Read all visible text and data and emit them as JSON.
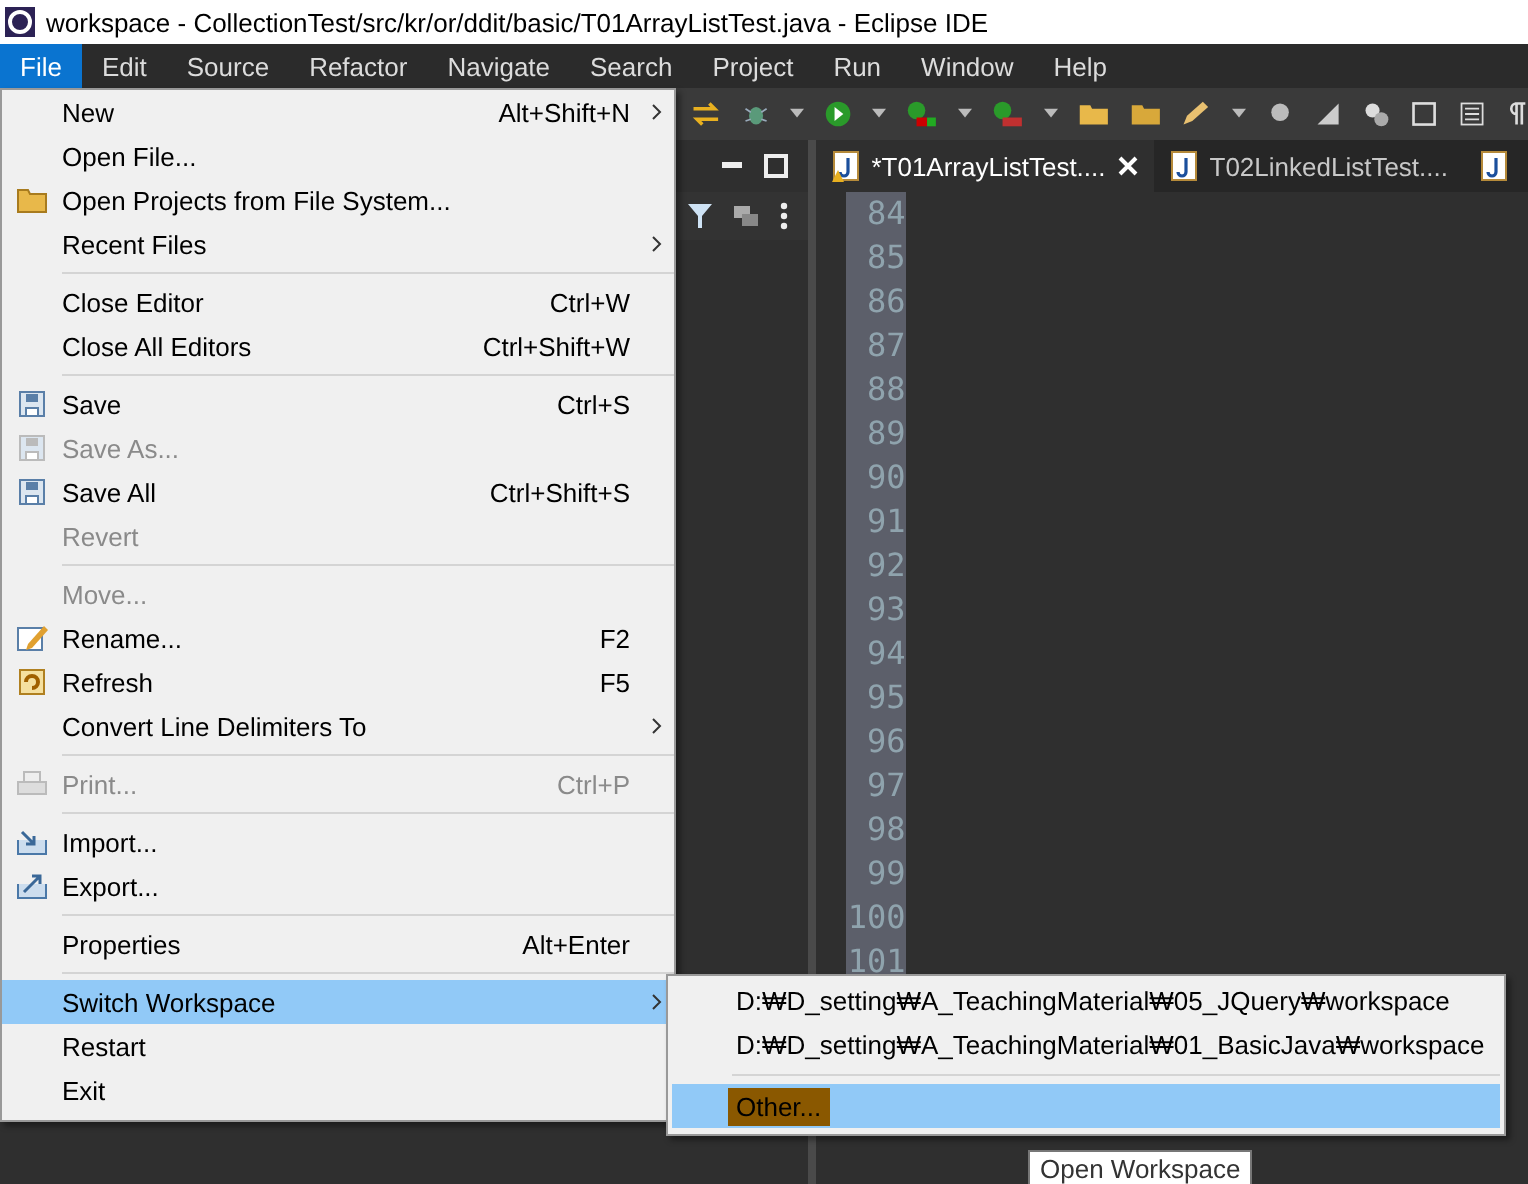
{
  "window": {
    "title": "workspace - CollectionTest/src/kr/or/ddit/basic/T01ArrayListTest.java - Eclipse IDE"
  },
  "menubar": [
    {
      "label": "File",
      "selected": true
    },
    {
      "label": "Edit",
      "selected": false
    },
    {
      "label": "Source",
      "selected": false
    },
    {
      "label": "Refactor",
      "selected": false
    },
    {
      "label": "Navigate",
      "selected": false
    },
    {
      "label": "Search",
      "selected": false
    },
    {
      "label": "Project",
      "selected": false
    },
    {
      "label": "Run",
      "selected": false
    },
    {
      "label": "Window",
      "selected": false
    },
    {
      "label": "Help",
      "selected": false
    }
  ],
  "file_menu": [
    {
      "kind": "item",
      "label": "New",
      "shortcut": "Alt+Shift+N",
      "submenu": true,
      "disabled": false,
      "selected": false
    },
    {
      "kind": "item",
      "label": "Open File...",
      "disabled": false,
      "selected": false
    },
    {
      "kind": "item",
      "label": "Open Projects from File System...",
      "disabled": false,
      "selected": false
    },
    {
      "kind": "item",
      "label": "Recent Files",
      "submenu": true,
      "disabled": false,
      "selected": false
    },
    {
      "kind": "separator"
    },
    {
      "kind": "item",
      "label": "Close Editor",
      "shortcut": "Ctrl+W",
      "disabled": false,
      "selected": false
    },
    {
      "kind": "item",
      "label": "Close All Editors",
      "shortcut": "Ctrl+Shift+W",
      "disabled": false,
      "selected": false
    },
    {
      "kind": "separator"
    },
    {
      "kind": "item",
      "label": "Save",
      "shortcut": "Ctrl+S",
      "disabled": false,
      "selected": false
    },
    {
      "kind": "item",
      "label": "Save As...",
      "disabled": true,
      "selected": false
    },
    {
      "kind": "item",
      "label": "Save All",
      "shortcut": "Ctrl+Shift+S",
      "disabled": false,
      "selected": false
    },
    {
      "kind": "item",
      "label": "Revert",
      "disabled": true,
      "selected": false
    },
    {
      "kind": "separator"
    },
    {
      "kind": "item",
      "label": "Move...",
      "disabled": true,
      "selected": false
    },
    {
      "kind": "item",
      "label": "Rename...",
      "shortcut": "F2",
      "disabled": false,
      "selected": false
    },
    {
      "kind": "item",
      "label": "Refresh",
      "shortcut": "F5",
      "disabled": false,
      "selected": false
    },
    {
      "kind": "item",
      "label": "Convert Line Delimiters To",
      "submenu": true,
      "disabled": false,
      "selected": false
    },
    {
      "kind": "separator"
    },
    {
      "kind": "item",
      "label": "Print...",
      "shortcut": "Ctrl+P",
      "disabled": true,
      "selected": false
    },
    {
      "kind": "separator"
    },
    {
      "kind": "item",
      "label": "Import...",
      "disabled": false,
      "selected": false
    },
    {
      "kind": "item",
      "label": "Export...",
      "disabled": false,
      "selected": false
    },
    {
      "kind": "separator"
    },
    {
      "kind": "item",
      "label": "Properties",
      "shortcut": "Alt+Enter",
      "disabled": false,
      "selected": false
    },
    {
      "kind": "separator"
    },
    {
      "kind": "item",
      "label": "Switch Workspace",
      "submenu": true,
      "disabled": false,
      "selected": true
    },
    {
      "kind": "item",
      "label": "Restart",
      "disabled": false,
      "selected": false
    },
    {
      "kind": "item",
      "label": "Exit",
      "disabled": false,
      "selected": false
    }
  ],
  "workspace_submenu": [
    {
      "kind": "item",
      "label": "D:₩D_setting₩A_TeachingMaterial₩05_JQuery₩workspace",
      "selected": false,
      "marked": false
    },
    {
      "kind": "item",
      "label": "D:₩D_setting₩A_TeachingMaterial₩01_BasicJava₩workspace",
      "selected": false,
      "marked": false
    },
    {
      "kind": "separator"
    },
    {
      "kind": "item",
      "label": "Other...",
      "selected": true,
      "marked": true
    }
  ],
  "editor_tabs": [
    {
      "label": "*T01ArrayListTest....",
      "selected": true,
      "warning": true
    },
    {
      "label": "T02LinkedListTest....",
      "selected": false,
      "warning": false
    },
    {
      "selected": false,
      "warning": false
    }
  ],
  "line_numbers": [
    "84",
    "85",
    "86",
    "87",
    "88",
    "89",
    "90",
    "91",
    "92",
    "93",
    "94",
    "95",
    "96",
    "97",
    "98",
    "99",
    "100",
    "101"
  ],
  "tooltip": "Open Workspace"
}
